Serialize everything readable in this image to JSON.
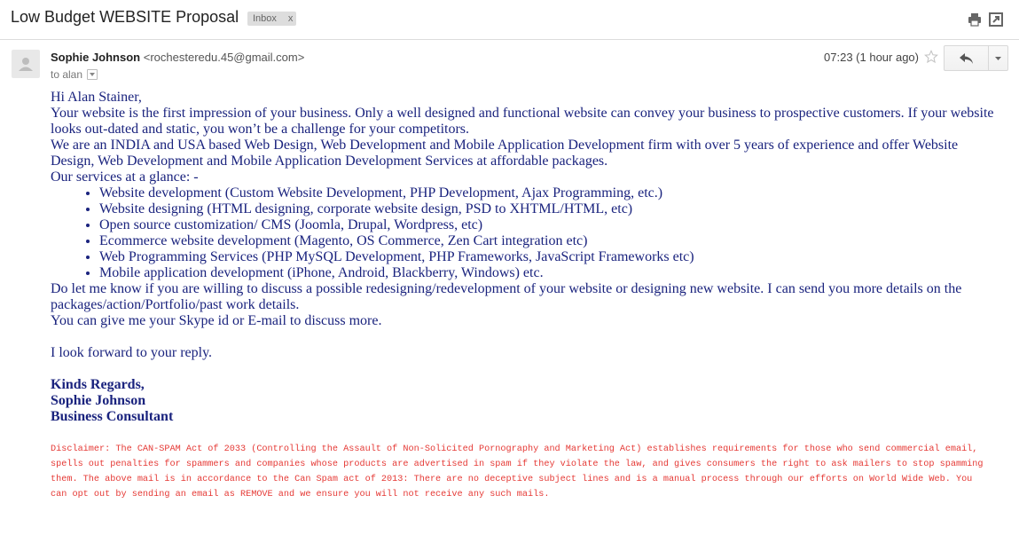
{
  "header": {
    "subject": "Low Budget WEBSITE Proposal",
    "label": "Inbox",
    "label_remove": "x"
  },
  "icons": {
    "print": "printer-icon",
    "new_window": "new-window-icon",
    "avatar": "person-icon",
    "star": "star-icon",
    "reply": "reply-icon",
    "more": "chevron-down-icon"
  },
  "message": {
    "sender_name": "Sophie Johnson",
    "sender_email": "<rochesteredu.45@gmail.com>",
    "to": "to alan",
    "time": "07:23 (1 hour ago)"
  },
  "body": {
    "greeting": "Hi Alan Stainer,",
    "para1": "Your website is the first impression of your business. Only a well designed and functional website can convey your business to prospective customers. If your website looks out-dated and static, you won’t be a challenge for your competitors.",
    "para2": "We are an INDIA and USA based Web Design, Web Development and Mobile Application Development firm with over 5 years of experience and offer Website Design, Web Development and Mobile Application Development Services at affordable packages.",
    "services_intro": "Our services at a glance: -",
    "services": [
      "Website development (Custom Website Development, PHP Development, Ajax Programming, etc.)",
      "Website designing (HTML designing, corporate website design, PSD to XHTML/HTML, etc)",
      "Open source customization/ CMS (Joomla, Drupal, Wordpress, etc)",
      "Ecommerce website development (Magento, OS Commerce, Zen Cart integration etc)",
      "Web Programming Services (PHP MySQL Development, PHP Frameworks, JavaScript Frameworks etc)",
      "Mobile application development (iPhone, Android, Blackberry, Windows) etc."
    ],
    "para3": "Do let me know if you are willing to discuss a possible redesigning/redevelopment of your website or designing new website. I can send you more details on the packages/action/Portfolio/past work details.",
    "para4": "You can give me your Skype id or E-mail to discuss more.",
    "closing": "I look forward to your reply.",
    "sign_regards": "Kinds Regards,",
    "sign_name": "Sophie Johnson",
    "sign_title": "Business Consultant",
    "disclaimer": "Disclaimer: The CAN-SPAM Act of 2033 (Controlling the Assault of Non-Solicited Pornography and Marketing Act) establishes requirements for those who send commercial email, spells out penalties for spammers and companies whose products are advertised in spam if they violate the law, and gives consumers the right to ask mailers to stop spamming them. The above mail is in accordance to the Can Spam act of 2013: There are no deceptive subject lines and is a manual process through our efforts on World Wide Web. You can opt out by sending an email as REMOVE and we ensure you will not receive any such mails."
  },
  "colors": {
    "body_text": "#1a237e",
    "disclaimer": "#e53935"
  }
}
